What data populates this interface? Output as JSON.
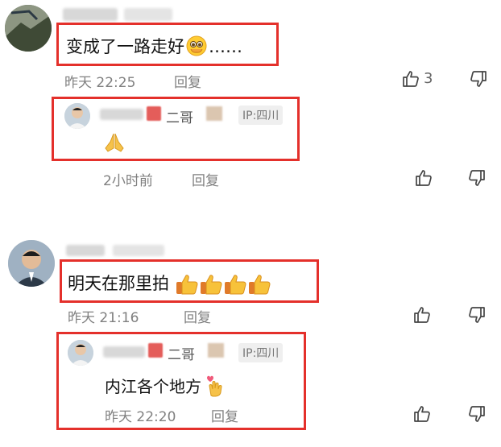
{
  "comments": [
    {
      "text": "变成了一路走好",
      "ellipsis": "……",
      "time": "昨天 22:25",
      "reply_label": "回复",
      "like_count": "3",
      "replies": [
        {
          "nickname_suffix": "二哥",
          "ip_label": "IP:四川",
          "text": "",
          "time": "2小时前",
          "reply_label": "回复"
        }
      ]
    },
    {
      "text": "明天在那里拍",
      "time": "昨天 21:16",
      "reply_label": "回复",
      "replies": [
        {
          "nickname_suffix": "二哥",
          "ip_label": "IP:四川",
          "text": "内江各个地方",
          "time": "昨天 22:20",
          "reply_label": "回复"
        }
      ]
    }
  ],
  "colors": {
    "highlight": "#e4302b",
    "meta": "#808080"
  },
  "icons": [
    "thumbs-up-icon",
    "thumbs-down-icon",
    "pleading-face-emoji",
    "praying-hands-emoji",
    "thumbs-up-emoji",
    "sparkling-heart-hand-emoji"
  ]
}
